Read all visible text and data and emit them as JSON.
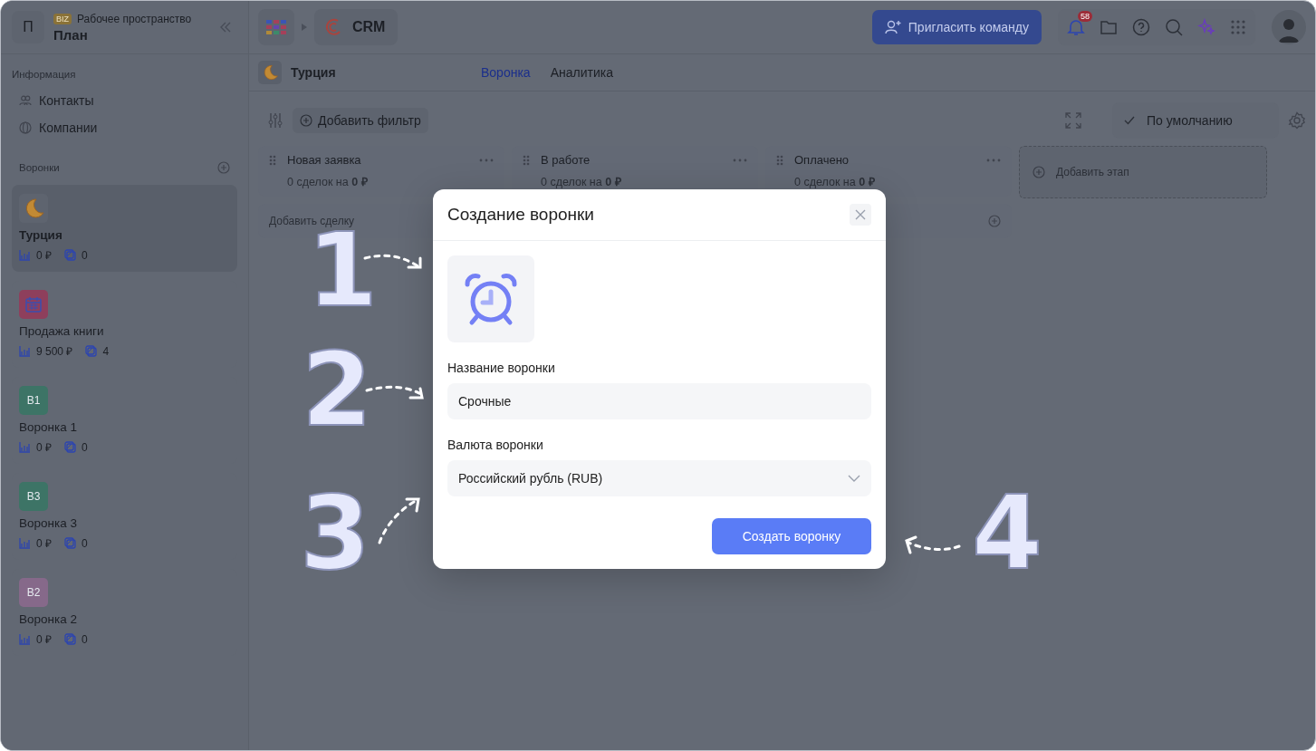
{
  "workspace": {
    "initial": "П",
    "badge": "BIZ",
    "label": "Рабочее пространство",
    "name": "План"
  },
  "breadcrumb": {
    "app": "CRM"
  },
  "invite_button": "Пригласить команду",
  "notifications_badge": "58",
  "sidebar": {
    "info_heading": "Информация",
    "info_items": [
      {
        "label": "Контакты",
        "kind": "contacts"
      },
      {
        "label": "Компании",
        "kind": "companies"
      }
    ],
    "funnels_heading": "Воронки",
    "funnels": [
      {
        "name": "Турция",
        "kind": "moon",
        "amount": "0 ₽",
        "count": "0",
        "selected": true
      },
      {
        "name": "Продажа книги",
        "kind": "calendar",
        "color": "#8e3f5c",
        "amount": "9 500 ₽",
        "count": "4",
        "selected": false
      },
      {
        "name": "Воронка 1",
        "kind": "initials",
        "initials": "B1",
        "color": "#3d7466",
        "amount": "0 ₽",
        "count": "0",
        "selected": false
      },
      {
        "name": "Воронка 3",
        "kind": "initials",
        "initials": "B3",
        "color": "#3d7466",
        "amount": "0 ₽",
        "count": "0",
        "selected": false
      },
      {
        "name": "Воронка 2",
        "kind": "initials",
        "initials": "B2",
        "color": "#86698a",
        "amount": "0 ₽",
        "count": "0",
        "selected": false
      }
    ]
  },
  "page": {
    "title": "Турция",
    "tabs": [
      {
        "label": "Воронка",
        "selected": true
      },
      {
        "label": "Аналитика",
        "selected": false
      }
    ],
    "add_filter": "Добавить фильтр",
    "view": "По умолчанию",
    "stages": [
      {
        "name": "Новая заявка",
        "summary": "0 сделок на **0 ₽**",
        "add_deal": "Добавить сделку"
      },
      {
        "name": "В работе",
        "summary": "0 сделок на **0 ₽**"
      },
      {
        "name": "Оплачено",
        "summary": "0 сделок на **0 ₽**"
      }
    ],
    "add_stage": "Добавить этап"
  },
  "modal": {
    "title": "Создание воронки",
    "name_label": "Название воронки",
    "name_value": "Срочные",
    "currency_label": "Валюта воронки",
    "currency_value": "Российский рубль (RUB)",
    "submit": "Создать воронку"
  },
  "annotations": [
    "1",
    "2",
    "3",
    "4"
  ]
}
